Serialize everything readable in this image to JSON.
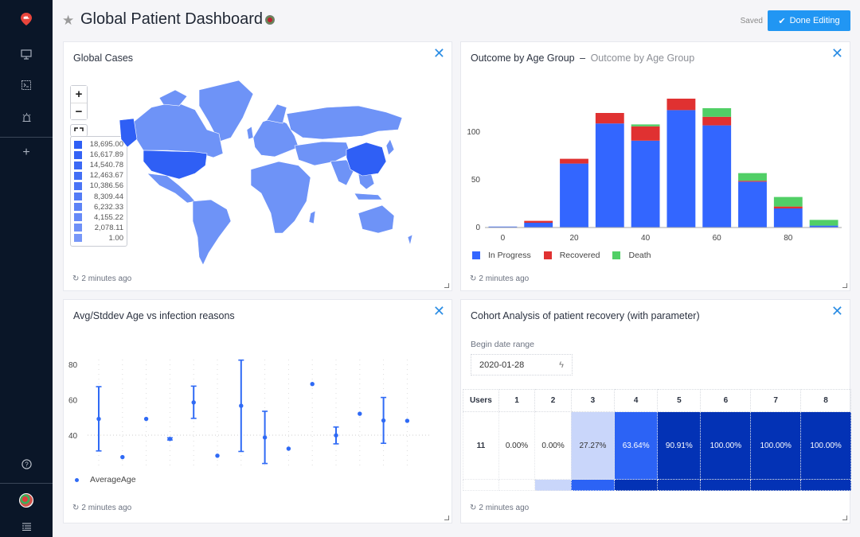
{
  "sidebar": {
    "logo": "superset-logo-icon",
    "items": [
      {
        "name": "dashboards",
        "icon": "monitor-icon"
      },
      {
        "name": "sql-lab",
        "icon": "terminal-icon"
      },
      {
        "name": "alerts",
        "icon": "alarm-icon"
      },
      {
        "name": "new",
        "icon": "plus-icon",
        "label": "+"
      }
    ],
    "bottom_items": [
      {
        "name": "help",
        "icon": "help-icon",
        "label": "?"
      },
      {
        "name": "user",
        "icon": "avatar-icon"
      },
      {
        "name": "menu",
        "icon": "menu-icon"
      }
    ]
  },
  "header": {
    "title": "Global Patient Dashboard",
    "saved_label": "Saved",
    "done_button": "Done Editing",
    "done_icon": "✔"
  },
  "cards": {
    "map": {
      "title": "Global Cases",
      "updated": "2 minutes ago",
      "zoom_in": "+",
      "zoom_out": "−",
      "legend": [
        {
          "value": "18,695.00",
          "color": "#2f5ff5"
        },
        {
          "value": "16,617.89",
          "color": "#3563f5"
        },
        {
          "value": "14,540.78",
          "color": "#3c69f5"
        },
        {
          "value": "12,463.67",
          "color": "#436ff5"
        },
        {
          "value": "10,386.56",
          "color": "#4b75f6"
        },
        {
          "value": "8,309.44",
          "color": "#547cf6"
        },
        {
          "value": "6,232.33",
          "color": "#5d83f6"
        },
        {
          "value": "4,155.22",
          "color": "#668af7"
        },
        {
          "value": "2,078.11",
          "color": "#6e90f7"
        },
        {
          "value": "1.00",
          "color": "#7797f8"
        }
      ]
    },
    "bars": {
      "title": "Outcome by Age Group",
      "subtitle": "Outcome by Age Group",
      "separator": "–",
      "updated": "2 minutes ago"
    },
    "scatter": {
      "title": "Avg/Stddev Age vs infection reasons",
      "updated": "2 minutes ago",
      "legend": "AverageAge"
    },
    "cohort": {
      "title": "Cohort Analysis of patient recovery (with parameter)",
      "updated": "2 minutes ago",
      "filter_label": "Begin date range",
      "filter_value": "2020-01-28",
      "headers": [
        "Users",
        "1",
        "2",
        "3",
        "4",
        "5",
        "6",
        "7",
        "8"
      ],
      "row": {
        "users": "11",
        "values": [
          "0.00%",
          "0.00%",
          "27.27%",
          "63.64%",
          "90.91%",
          "100.00%",
          "100.00%",
          "100.00%"
        ],
        "fractions": [
          0,
          0,
          0.2727,
          0.6364,
          0.9091,
          1,
          1,
          1
        ]
      }
    }
  },
  "chart_data": [
    {
      "type": "map",
      "title": "Global Cases",
      "legend_values": [
        18695.0,
        16617.89,
        14540.78,
        12463.67,
        10386.56,
        8309.44,
        6232.33,
        4155.22,
        2078.11,
        1.0
      ],
      "highlighted": [
        "United States",
        "China",
        "Alaska"
      ]
    },
    {
      "type": "bar",
      "stacked": true,
      "title": "Outcome by Age Group",
      "categories": [
        0,
        10,
        20,
        30,
        40,
        50,
        60,
        70,
        80,
        90
      ],
      "xticks": [
        0,
        20,
        40,
        60,
        80
      ],
      "yticks": [
        0,
        50,
        100
      ],
      "ylim": [
        0,
        140
      ],
      "legend": "bottom-left",
      "series": [
        {
          "name": "In Progress",
          "color": "#3366ff",
          "values": [
            1,
            5,
            67,
            109,
            91,
            123,
            107,
            48,
            20,
            2
          ]
        },
        {
          "name": "Recovered",
          "color": "#e03131",
          "values": [
            0,
            2,
            5,
            11,
            15,
            12,
            9,
            1,
            2,
            0
          ]
        },
        {
          "name": "Death",
          "color": "#51cf66",
          "values": [
            0,
            0,
            0,
            0,
            2,
            0,
            9,
            8,
            10,
            6
          ]
        }
      ]
    },
    {
      "type": "scatter",
      "title": "Avg/Stddev Age vs infection reasons",
      "yticks": [
        40,
        60,
        80
      ],
      "ylim": [
        22,
        85
      ],
      "legend": "bottom-left",
      "series": [
        {
          "name": "AverageAge",
          "color": "#2f6af5",
          "points": [
            {
              "mean": 49.2,
              "low": 31.1,
              "high": 67.4
            },
            {
              "mean": 27.6
            },
            {
              "mean": 49.2
            },
            {
              "mean": 37.9,
              "low": 37.3,
              "high": 38.5
            },
            {
              "mean": 58.5,
              "low": 49.5,
              "high": 67.7
            },
            {
              "mean": 28.4
            },
            {
              "mean": 56.6,
              "low": 30.8,
              "high": 82.4
            },
            {
              "mean": 38.7,
              "low": 24.0,
              "high": 53.5
            },
            {
              "mean": 32.4
            },
            {
              "mean": 68.9
            },
            {
              "mean": 39.9,
              "low": 35.1,
              "high": 44.6
            },
            {
              "mean": 52.1
            },
            {
              "mean": 48.3,
              "low": 35.4,
              "high": 61.3
            },
            {
              "mean": 48.1
            }
          ]
        }
      ]
    }
  ]
}
